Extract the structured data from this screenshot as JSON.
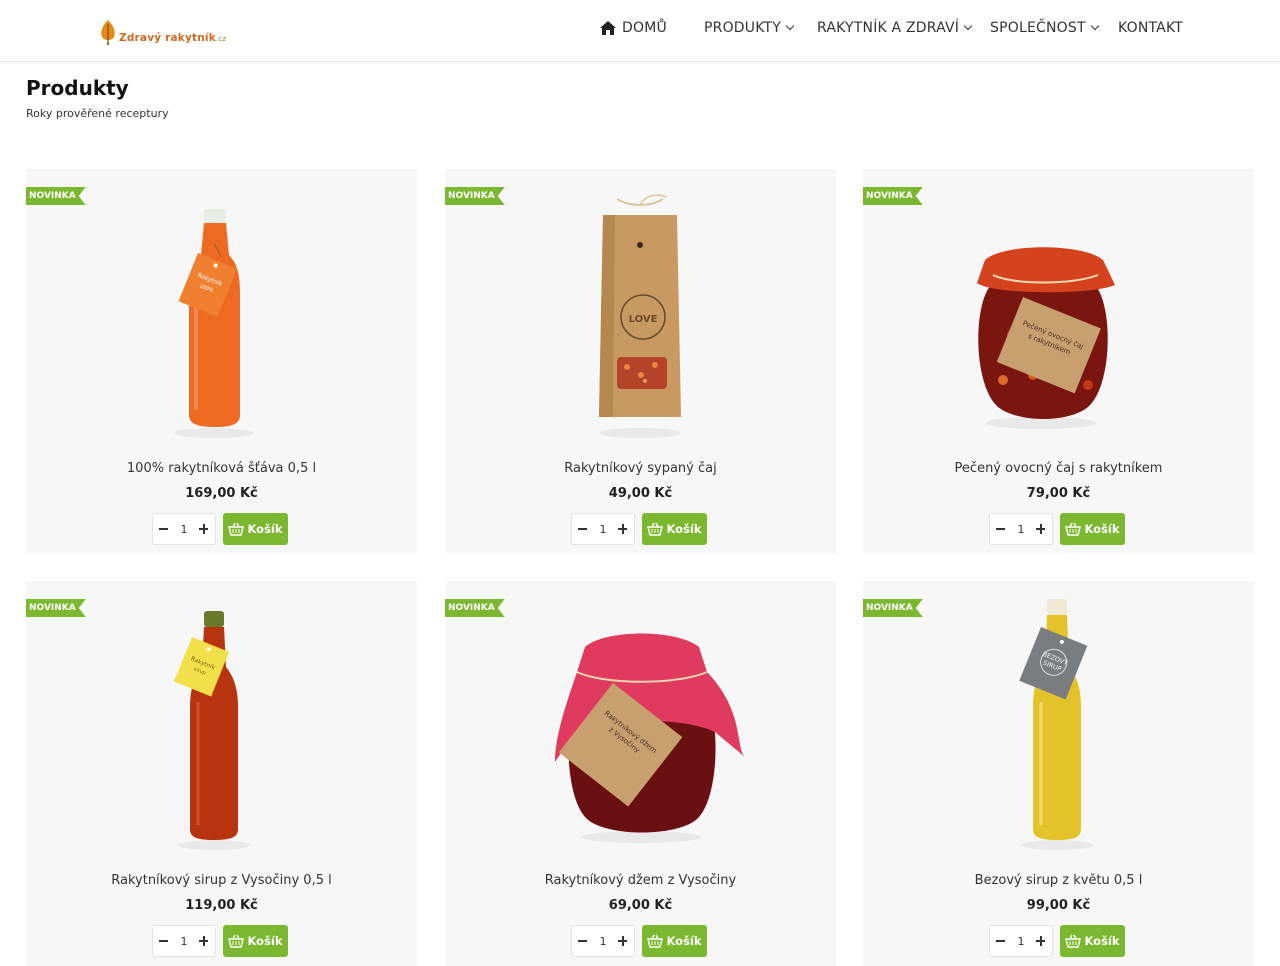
{
  "header": {
    "logo_text_main": "Zdravý rakytník",
    "logo_text_suffix": ".cz",
    "nav": [
      {
        "label": "DOMŮ",
        "icon": "home-icon"
      },
      {
        "label": "PRODUKTY",
        "icon": "chevron-down-icon"
      },
      {
        "label": "RAKYTNÍK A ZDRAVÍ",
        "icon": "chevron-down-icon"
      },
      {
        "label": "SPOLEČNOST",
        "icon": "chevron-down-icon"
      },
      {
        "label": "KONTAKT"
      }
    ]
  },
  "page": {
    "title": "Produkty",
    "subtitle": "Roky prověřené receptury"
  },
  "products": [
    {
      "badge": "NOVINKA",
      "name": "100% rakytníková šťáva 0,5 l",
      "price": "169,00 Kč",
      "qty": "1",
      "cart_label": "Košík",
      "image": "orange-juice-bottle"
    },
    {
      "badge": "NOVINKA",
      "name": "Rakytníkový sypaný čaj",
      "price": "49,00 Kč",
      "qty": "1",
      "cart_label": "Košík",
      "image": "kraft-tea-bag"
    },
    {
      "badge": "NOVINKA",
      "name": "Pečený ovocný čaj s rakytníkem",
      "price": "79,00 Kč",
      "qty": "1",
      "cart_label": "Košík",
      "image": "red-jar"
    },
    {
      "badge": "NOVINKA",
      "name": "Rakytníkový sirup z Vysočiny 0,5 l",
      "price": "119,00 Kč",
      "qty": "1",
      "cart_label": "Košík",
      "image": "red-syrup-bottle"
    },
    {
      "badge": "NOVINKA",
      "name": "Rakytníkový džem z Vysočiny",
      "price": "69,00 Kč",
      "qty": "1",
      "cart_label": "Košík",
      "image": "pink-jam-jar"
    },
    {
      "badge": "NOVINKA",
      "name": "Bezový sirup z květu 0,5 l",
      "price": "99,00 Kč",
      "qty": "1",
      "cart_label": "Košík",
      "image": "yellow-syrup-bottle"
    }
  ],
  "colors": {
    "accent": "#7cb82f",
    "card_bg": "#f7f7f7"
  }
}
